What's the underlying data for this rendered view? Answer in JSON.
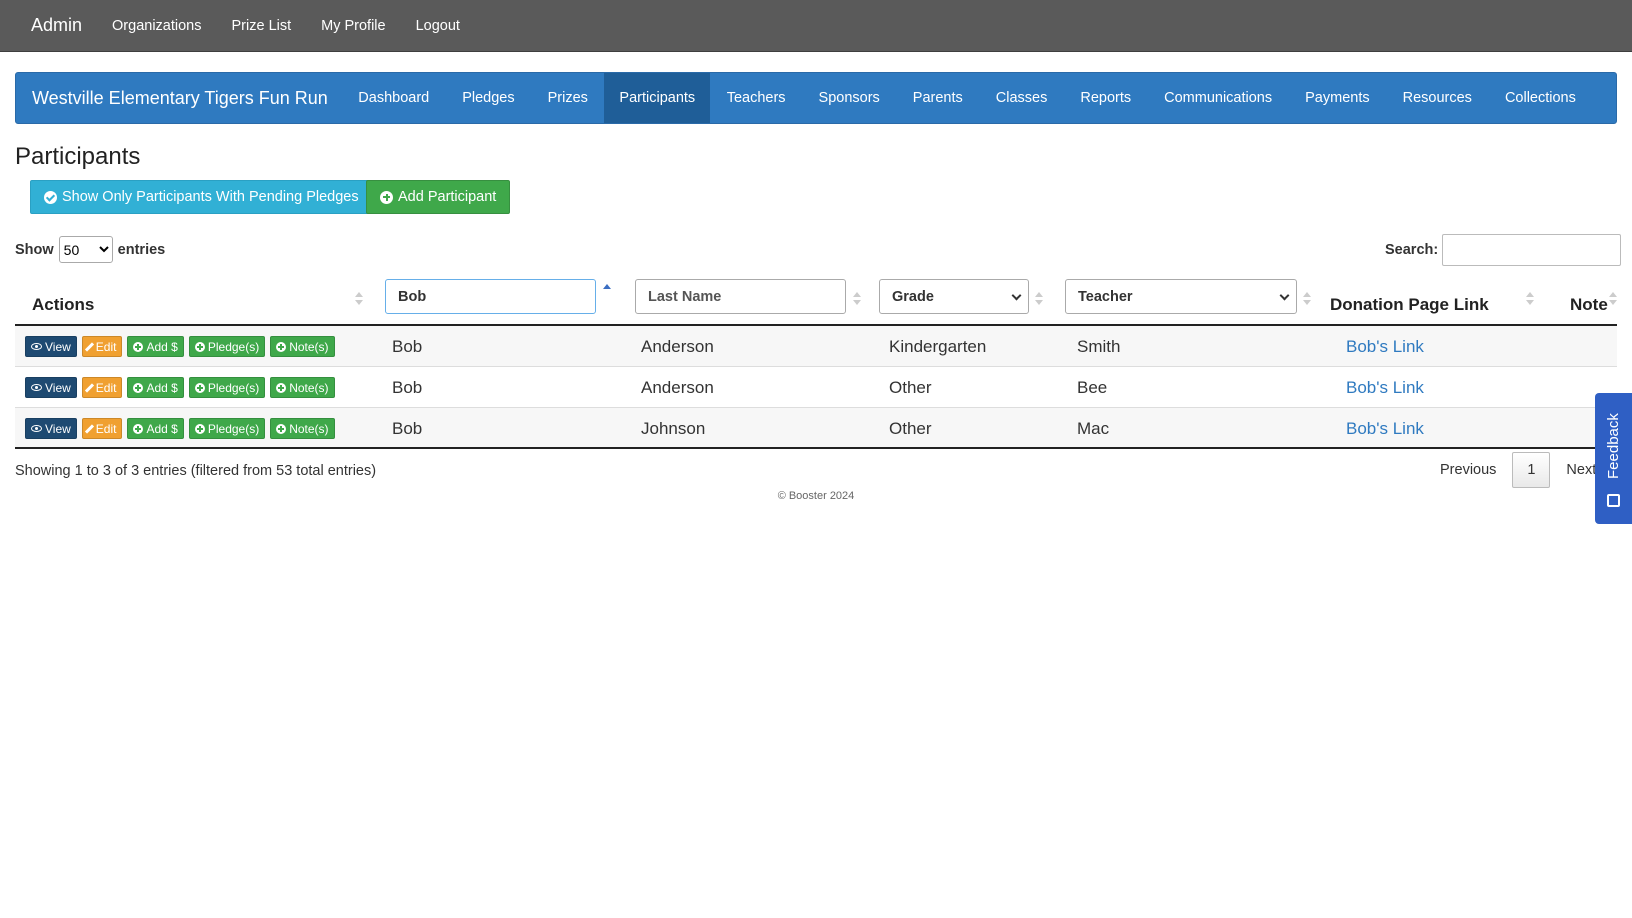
{
  "topbar": {
    "brand": "Admin",
    "links": [
      "Organizations",
      "Prize List",
      "My Profile",
      "Logout"
    ]
  },
  "orgbar": {
    "title": "Westville Elementary Tigers Fun Run",
    "items": [
      "Dashboard",
      "Pledges",
      "Prizes",
      "Participants",
      "Teachers",
      "Sponsors",
      "Parents",
      "Classes",
      "Reports",
      "Communications",
      "Payments",
      "Resources",
      "Collections"
    ],
    "active": "Participants"
  },
  "page": {
    "title": "Participants",
    "pending_button": "Show Only Participants With Pending Pledges",
    "add_button": "Add Participant"
  },
  "length": {
    "show_label": "Show",
    "value": "50",
    "entries_label": "entries"
  },
  "search": {
    "label": "Search:",
    "value": ""
  },
  "table": {
    "headers": {
      "actions": "Actions",
      "first_name_filter_value": "Bob",
      "last_name_placeholder": "Last Name",
      "grade_select": "Grade",
      "teacher_select": "Teacher",
      "donation_link": "Donation Page Link",
      "note": "Note"
    },
    "action_labels": {
      "view": "View",
      "edit": "Edit",
      "add": "Add $",
      "pledges": "Pledge(s)",
      "notes": "Note(s)"
    },
    "rows": [
      {
        "first": "Bob",
        "last": "Anderson",
        "grade": "Kindergarten",
        "teacher": "Smith",
        "link": "Bob's Link"
      },
      {
        "first": "Bob",
        "last": "Anderson",
        "grade": "Other",
        "teacher": "Bee",
        "link": "Bob's Link"
      },
      {
        "first": "Bob",
        "last": "Johnson",
        "grade": "Other",
        "teacher": "Mac",
        "link": "Bob's Link"
      }
    ]
  },
  "info": "Showing 1 to 3 of 3 entries (filtered from 53 total entries)",
  "pager": {
    "previous": "Previous",
    "current": "1",
    "next": "Next"
  },
  "footer": "© Booster 2024",
  "feedback": "Feedback",
  "colors": {
    "topbar": "#5a5a5a",
    "orgbar": "#2f7ac0",
    "info_btn": "#31b0d5",
    "success_btn": "#3fa84a",
    "link": "#2f7ac0",
    "feedback": "#2f5fc4"
  }
}
